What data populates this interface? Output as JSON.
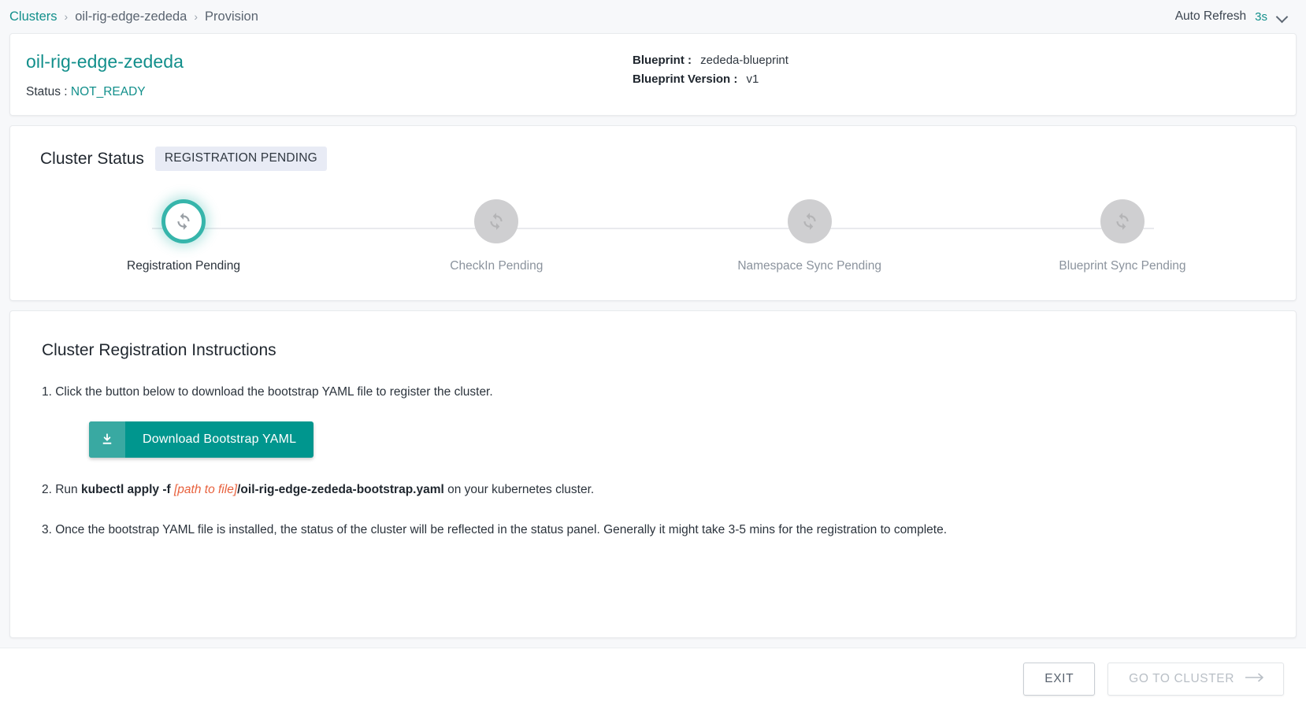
{
  "breadcrumb": {
    "items": [
      {
        "label": "Clusters",
        "type": "link"
      },
      {
        "label": "oil-rig-edge-zededa",
        "type": "text"
      },
      {
        "label": "Provision",
        "type": "current"
      }
    ],
    "separator": "›"
  },
  "auto_refresh": {
    "label": "Auto Refresh",
    "value": "3s",
    "chevron_icon": "chevron-down-icon"
  },
  "cluster": {
    "name": "oil-rig-edge-zededa",
    "status_label": "Status :",
    "status_value": "NOT_READY",
    "blueprint_label": "Blueprint :",
    "blueprint_value": "zededa-blueprint",
    "blueprint_version_label": "Blueprint Version :",
    "blueprint_version_value": "v1"
  },
  "cluster_status": {
    "title": "Cluster Status",
    "badge": "REGISTRATION PENDING",
    "steps": [
      {
        "label": "Registration Pending",
        "state": "active",
        "icon": "sync-icon"
      },
      {
        "label": "CheckIn Pending",
        "state": "pending",
        "icon": "sync-icon"
      },
      {
        "label": "Namespace Sync Pending",
        "state": "pending",
        "icon": "sync-icon"
      },
      {
        "label": "Blueprint Sync Pending",
        "state": "pending",
        "icon": "sync-icon"
      }
    ]
  },
  "instructions": {
    "title": "Cluster Registration Instructions",
    "step1": "1. Click the button below to download the bootstrap YAML file to register the cluster.",
    "download_button": {
      "label": "Download Bootstrap YAML",
      "icon": "download-icon"
    },
    "step2": {
      "prefix": "2. Run",
      "command": "kubectl apply -f",
      "path_placeholder": "[path to file]",
      "filename": "/oil-rig-edge-zededa-bootstrap.yaml",
      "suffix": "on your kubernetes cluster."
    },
    "step3": "3. Once the bootstrap YAML file is installed, the status of the cluster will be reflected in the status panel. Generally it might take 3-5 mins for the registration to complete."
  },
  "footer": {
    "exit_label": "EXIT",
    "goto_label": "GO TO CLUSTER",
    "arrow_icon": "arrow-right-icon"
  },
  "colors": {
    "accent": "#128f8b",
    "button": "#00968e",
    "step_active": "#36b5ab",
    "badge_bg": "#e8ebf5",
    "path_highlight": "#e8603c"
  }
}
